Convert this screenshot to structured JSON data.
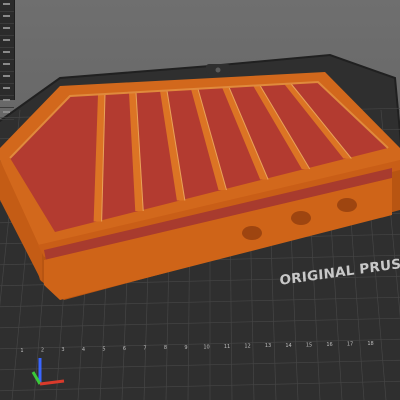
{
  "printer_bed": {
    "label": "ORIGINAL PRUSA",
    "ruler_ticks": [
      "1",
      "2",
      "3",
      "4",
      "5",
      "6",
      "7",
      "8",
      "9",
      "10",
      "11",
      "12",
      "13",
      "14",
      "15",
      "16",
      "17",
      "18"
    ]
  },
  "model": {
    "compartment_count": 8,
    "thumb_holes": 3
  },
  "colors": {
    "background": "#646464",
    "bed_surface": "#2f2f2f",
    "bed_grid": "#4a4a4a",
    "model_orange": "#d2681c",
    "model_red": "#b33b30",
    "x_axis": "#d93a2b",
    "y_axis": "#3ac83a",
    "z_axis": "#3a66ff"
  },
  "icons": {
    "side_panel": "slider-list-icon",
    "axes": "axis-gizmo-icon"
  }
}
